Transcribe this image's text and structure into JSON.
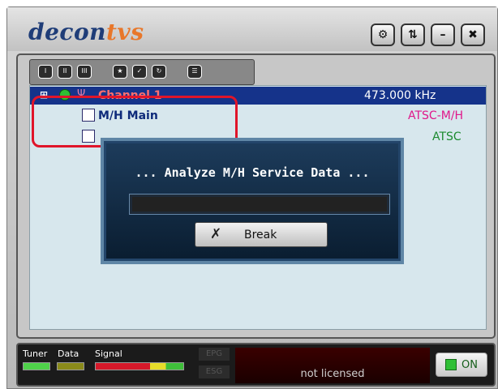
{
  "app": {
    "logo_prefix": "decon",
    "logo_suffix": "tvs"
  },
  "title_buttons": [
    "tools-icon",
    "info-icon",
    "minimize-icon",
    "close-icon"
  ],
  "toolbar": {
    "icons": [
      "view-1-icon",
      "view-2-icon",
      "view-3-icon",
      "scan-icon",
      "edit-icon",
      "refresh-icon",
      "list-icon"
    ]
  },
  "tree": {
    "rows": [
      {
        "label": "Channel 1",
        "freq": "473.000 kHz"
      },
      {
        "label": "M/H Main",
        "type": "ATSC-M/H"
      },
      {
        "label": "",
        "type": "ATSC"
      }
    ]
  },
  "dialog": {
    "title": "... Analyze M/H Service Data ...",
    "progress": 0,
    "button_label": "Break"
  },
  "status": {
    "tuner": "Tuner",
    "data": "Data",
    "signal": "Signal",
    "epg": "EPG",
    "esg": "ESG",
    "license": "not licensed",
    "on": "ON"
  },
  "colors": {
    "accent": "#15338a",
    "channel": "#ff6f6f",
    "mh_type": "#e0178a",
    "atsc_type": "#1c8a2f",
    "highlight": "#e0152a"
  }
}
